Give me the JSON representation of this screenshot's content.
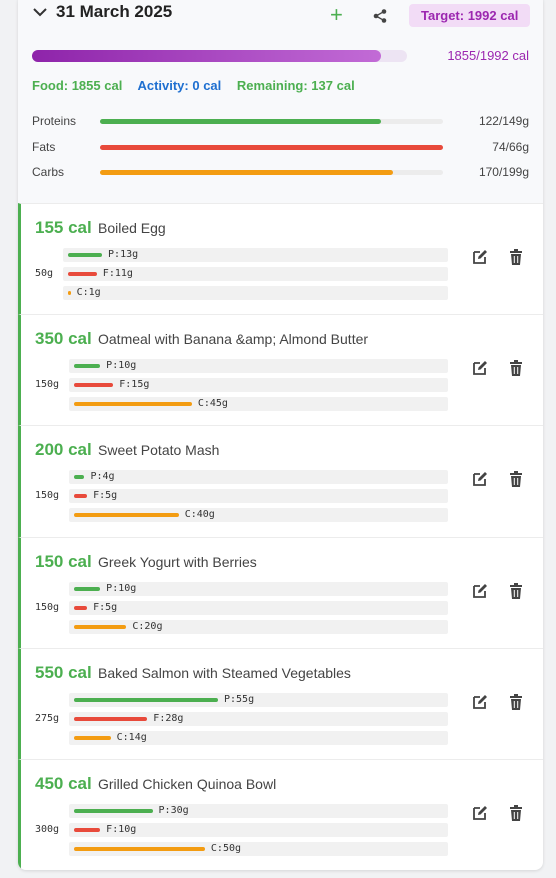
{
  "header": {
    "date": "31 March 2025",
    "add_label": "+",
    "target": "Target: 1992 cal",
    "total": "1855/1992 cal",
    "progress": 0.931
  },
  "stats": {
    "food": "Food: 1855 cal",
    "activity": "Activity: 0 cal",
    "remaining": "Remaining: 137 cal"
  },
  "macros": [
    {
      "label": "Proteins",
      "value": "122/149g",
      "fraction": 0.819,
      "color": "#4caf50"
    },
    {
      "label": "Fats",
      "value": "74/66g",
      "fraction": 1.0,
      "color": "#e84a3b"
    },
    {
      "label": "Carbs",
      "value": "170/199g",
      "fraction": 0.854,
      "color": "#f39c12"
    }
  ],
  "entries": [
    {
      "cal": "155 cal",
      "name": "Boiled Egg",
      "weight": "50g",
      "p_label": "P:13g",
      "f_label": "F:11g",
      "c_label": "C:1g",
      "p": 13,
      "f": 11,
      "c": 1
    },
    {
      "cal": "350 cal",
      "name": "Oatmeal with Banana &amp; Almond Butter",
      "weight": "150g",
      "p_label": "P:10g",
      "f_label": "F:15g",
      "c_label": "C:45g",
      "p": 10,
      "f": 15,
      "c": 45
    },
    {
      "cal": "200 cal",
      "name": "Sweet Potato Mash",
      "weight": "150g",
      "p_label": "P:4g",
      "f_label": "F:5g",
      "c_label": "C:40g",
      "p": 4,
      "f": 5,
      "c": 40
    },
    {
      "cal": "150 cal",
      "name": "Greek Yogurt with Berries",
      "weight": "150g",
      "p_label": "P:10g",
      "f_label": "F:5g",
      "c_label": "C:20g",
      "p": 10,
      "f": 5,
      "c": 20
    },
    {
      "cal": "550 cal",
      "name": "Baked Salmon with Steamed Vegetables",
      "weight": "275g",
      "p_label": "P:55g",
      "f_label": "F:28g",
      "c_label": "C:14g",
      "p": 55,
      "f": 28,
      "c": 14
    },
    {
      "cal": "450 cal",
      "name": "Grilled Chicken Quinoa Bowl",
      "weight": "300g",
      "p_label": "P:30g",
      "f_label": "F:10g",
      "c_label": "C:50g",
      "p": 30,
      "f": 10,
      "c": 50
    }
  ],
  "colors": {
    "protein": "#4caf50",
    "fat": "#e84a3b",
    "carb": "#f39c12",
    "accent": "#9c27b0"
  },
  "icons": {
    "collapse": "chevron-down-icon",
    "share": "share-icon",
    "edit": "edit-icon",
    "delete": "trash-icon"
  }
}
